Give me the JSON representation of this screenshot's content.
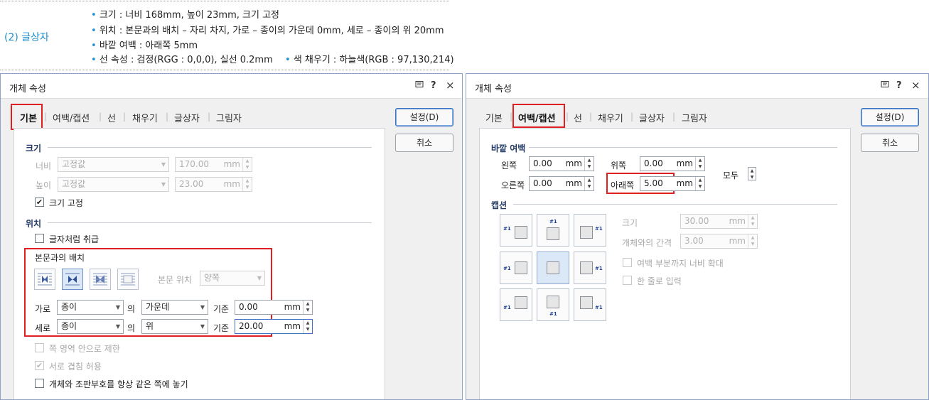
{
  "spec": {
    "heading": "(2) 글상자",
    "bullet": "•",
    "line1": "크기 : 너비 168mm, 높이 23mm, 크기 고정",
    "line2": "위치 : 본문과의 배치 – 자리 차지, 가로 – 종이의 가운데 0mm, 세로 – 종이의 위 20mm",
    "line3": "바깥 여백 : 아래쪽 5mm",
    "line4a": "선 속성 : 검정(RGG : 0,0,0), 실선 0.2mm",
    "line4b": "색 채우기 : 하늘색(RGB : 97,130,214)"
  },
  "dialog": {
    "title": "개체 속성",
    "tabs": [
      "기본",
      "여백/캡션",
      "선",
      "채우기",
      "글상자",
      "그림자"
    ],
    "tab_sep": "|",
    "ok_label": "설정(D)",
    "cancel_label": "취소",
    "icons": {
      "memo": "memo-icon",
      "help": "?",
      "close": "×"
    }
  },
  "basic": {
    "size_section": "크기",
    "width_label": "너비",
    "width_mode": "고정값",
    "width_value": "170.00",
    "height_label": "높이",
    "height_mode": "고정값",
    "height_value": "23.00",
    "unit": "mm",
    "fix_size_label": "크기 고정",
    "position_section": "위치",
    "treat_as_char_label": "글자처럼 취급",
    "wrap_group_label": "본문과의 배치",
    "text_position_label": "본문 위치",
    "text_position_value": "양쪽",
    "horiz_label": "가로",
    "horiz_rel": "종이",
    "of_label": "의",
    "horiz_align": "가운데",
    "base_label": "기준",
    "horiz_value": "0.00",
    "vert_label": "세로",
    "vert_rel": "종이",
    "vert_align": "위",
    "vert_value": "20.00",
    "limit_page_label": "쪽 영역 안으로 제한",
    "allow_overlap_label": "서로 겹침 허용",
    "same_page_label": "개체와 조판부호를 항상 같은 쪽에 놓기"
  },
  "margin": {
    "outer_section": "바깥 여백",
    "left_label": "왼쪽",
    "left_value": "0.00",
    "top_label": "위쪽",
    "top_value": "0.00",
    "right_label": "오른쪽",
    "right_value": "0.00",
    "bottom_label": "아래쪽",
    "bottom_value": "5.00",
    "all_label": "모두",
    "unit": "mm",
    "caption_section": "캡션",
    "caption_tag": "#1",
    "cap_size_label": "크기",
    "cap_size_value": "30.00",
    "cap_gap_label": "개체와의 간격",
    "cap_gap_value": "3.00",
    "cap_extend_label": "여백 부분까지 너비 확대",
    "cap_oneline_label": "한 줄로 입력"
  },
  "colors": {
    "accent": "#1e8fd2",
    "highlight": "#e02020"
  }
}
